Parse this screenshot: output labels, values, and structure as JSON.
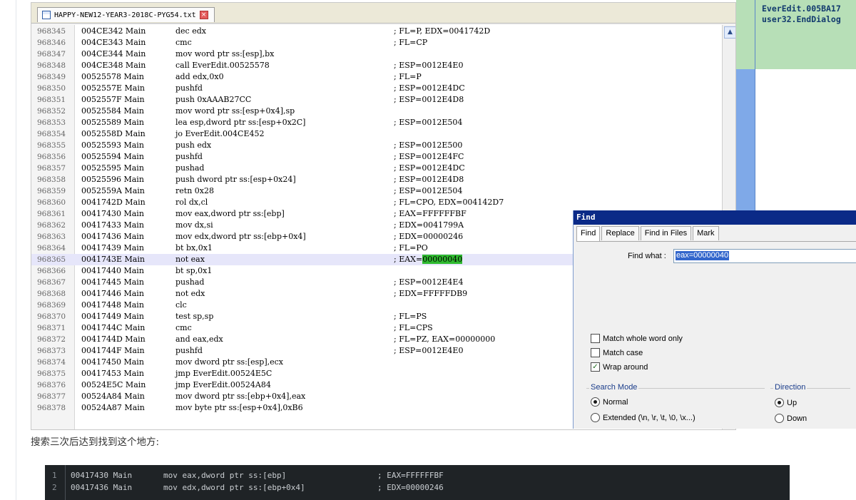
{
  "editor": {
    "tab_title": "HAPPY-NEW12-YEAR3-2018C-PYG54.txt",
    "rows": [
      {
        "n": "968345",
        "addr": "004CE342 Main",
        "ins": "dec edx",
        "cmt": "; FL=P, EDX=0041742D"
      },
      {
        "n": "968346",
        "addr": "004CE343 Main",
        "ins": "cmc",
        "cmt": "; FL=CP"
      },
      {
        "n": "968347",
        "addr": "004CE344 Main",
        "ins": "mov word ptr ss:[esp],bx",
        "cmt": ""
      },
      {
        "n": "968348",
        "addr": "004CE348 Main",
        "ins": "call EverEdit.00525578",
        "cmt": "; ESP=0012E4E0"
      },
      {
        "n": "968349",
        "addr": "00525578 Main",
        "ins": "add edx,0x0",
        "cmt": "; FL=P"
      },
      {
        "n": "968350",
        "addr": "0052557E Main",
        "ins": "pushfd",
        "cmt": "; ESP=0012E4DC"
      },
      {
        "n": "968351",
        "addr": "0052557F Main",
        "ins": "push 0xAAAB27CC",
        "cmt": "; ESP=0012E4D8"
      },
      {
        "n": "968352",
        "addr": "00525584 Main",
        "ins": "mov word ptr ss:[esp+0x4],sp",
        "cmt": ""
      },
      {
        "n": "968353",
        "addr": "00525589 Main",
        "ins": "lea esp,dword ptr ss:[esp+0x2C]",
        "cmt": "; ESP=0012E504"
      },
      {
        "n": "968354",
        "addr": "0052558D Main",
        "ins": "jo EverEdit.004CE452",
        "cmt": ""
      },
      {
        "n": "968355",
        "addr": "00525593 Main",
        "ins": "push edx",
        "cmt": "; ESP=0012E500"
      },
      {
        "n": "968356",
        "addr": "00525594 Main",
        "ins": "pushfd",
        "cmt": "; ESP=0012E4FC"
      },
      {
        "n": "968357",
        "addr": "00525595 Main",
        "ins": "pushad",
        "cmt": "; ESP=0012E4DC"
      },
      {
        "n": "968358",
        "addr": "00525596 Main",
        "ins": "push dword ptr ss:[esp+0x24]",
        "cmt": "; ESP=0012E4D8"
      },
      {
        "n": "968359",
        "addr": "0052559A Main",
        "ins": "retn 0x28",
        "cmt": "; ESP=0012E504"
      },
      {
        "n": "968360",
        "addr": "0041742D Main",
        "ins": "rol dx,cl",
        "cmt": "; FL=CPO, EDX=004142D7"
      },
      {
        "n": "968361",
        "addr": "00417430 Main",
        "ins": "mov eax,dword ptr ss:[ebp]",
        "cmt": "; EAX=FFFFFFBF"
      },
      {
        "n": "968362",
        "addr": "00417433 Main",
        "ins": "mov dx,si",
        "cmt": "; EDX=0041799A"
      },
      {
        "n": "968363",
        "addr": "00417436 Main",
        "ins": "mov edx,dword ptr ss:[ebp+0x4]",
        "cmt": "; EDX=00000246"
      },
      {
        "n": "968364",
        "addr": "00417439 Main",
        "ins": "bt bx,0x1",
        "cmt": "; FL=PO"
      },
      {
        "n": "968365",
        "addr": "0041743E Main",
        "ins": "not eax",
        "cmt": "; EAX=",
        "hl": "00000040"
      },
      {
        "n": "968366",
        "addr": "00417440 Main",
        "ins": "bt sp,0x1",
        "cmt": ""
      },
      {
        "n": "968367",
        "addr": "00417445 Main",
        "ins": "pushad",
        "cmt": "; ESP=0012E4E4"
      },
      {
        "n": "968368",
        "addr": "00417446 Main",
        "ins": "not edx",
        "cmt": "; EDX=FFFFFDB9"
      },
      {
        "n": "968369",
        "addr": "00417448 Main",
        "ins": "clc",
        "cmt": ""
      },
      {
        "n": "968370",
        "addr": "00417449 Main",
        "ins": "test sp,sp",
        "cmt": "; FL=PS"
      },
      {
        "n": "968371",
        "addr": "0041744C Main",
        "ins": "cmc",
        "cmt": "; FL=CPS"
      },
      {
        "n": "968372",
        "addr": "0041744D Main",
        "ins": "and eax,edx",
        "cmt": "; FL=PZ, EAX=00000000"
      },
      {
        "n": "968373",
        "addr": "0041744F Main",
        "ins": "pushfd",
        "cmt": "; ESP=0012E4E0"
      },
      {
        "n": "968374",
        "addr": "00417450 Main",
        "ins": "mov dword ptr ss:[esp],ecx",
        "cmt": ""
      },
      {
        "n": "968375",
        "addr": "00417453 Main",
        "ins": "jmp EverEdit.00524E5C",
        "cmt": ""
      },
      {
        "n": "968376",
        "addr": "00524E5C Main",
        "ins": "jmp EverEdit.00524A84",
        "cmt": ""
      },
      {
        "n": "968377",
        "addr": "00524A84 Main",
        "ins": "mov dword ptr ss:[ebp+0x4],eax",
        "cmt": ""
      },
      {
        "n": "968378",
        "addr": "00524A87 Main",
        "ins": "mov byte ptr ss:[esp+0x4],0xB6",
        "cmt": ""
      }
    ]
  },
  "side_panel": {
    "line1": "EverEdit.005BA17",
    "line2": "user32.EndDialog"
  },
  "find_dialog": {
    "title": "Find",
    "tabs": [
      "Find",
      "Replace",
      "Find in Files",
      "Mark"
    ],
    "find_what_label": "Find what :",
    "find_what_value": "eax=00000040",
    "match_whole_word": "Match whole word only",
    "match_case": "Match case",
    "wrap_around": "Wrap around",
    "search_mode_title": "Search Mode",
    "mode_normal": "Normal",
    "mode_extended": "Extended (\\n, \\r, \\t, \\0, \\x...)",
    "direction_title": "Direction",
    "dir_up": "Up",
    "dir_down": "Down",
    "wrap_checked": true
  },
  "caption": "搜索三次后达到找到这个地方:",
  "code_block": [
    {
      "n": "1",
      "addr": "00417430 Main",
      "ins": "mov eax,dword ptr ss:[ebp]",
      "cmt": "; EAX=FFFFFFBF"
    },
    {
      "n": "2",
      "addr": "00417436 Main",
      "ins": "mov edx,dword ptr ss:[ebp+0x4]",
      "cmt": "; EDX=00000246"
    }
  ]
}
